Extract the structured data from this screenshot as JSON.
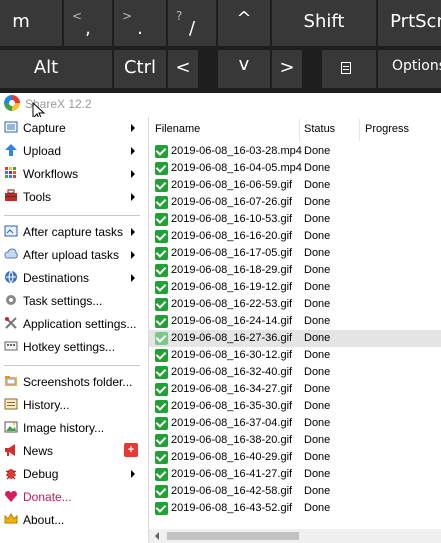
{
  "keyboard": {
    "keys_row1": [
      {
        "main": "m"
      },
      {
        "top": "<",
        "main": ","
      },
      {
        "top": ">",
        "main": "."
      },
      {
        "top": "?",
        "main": "/"
      },
      {
        "main": "^"
      },
      {
        "main": "Shift"
      },
      {
        "main": "PrtScn"
      }
    ],
    "keys_row2": [
      {
        "main": "Alt"
      },
      {
        "main": "Ctrl"
      },
      {
        "main": "<"
      },
      {
        "main": "v"
      },
      {
        "main": ">"
      },
      {
        "icon": "menu-key-icon"
      },
      {
        "main": "Options"
      }
    ]
  },
  "app": {
    "title": "ShareX 12.2",
    "menu": [
      {
        "label": "Capture",
        "icon": "capture-icon",
        "submenu": true
      },
      {
        "label": "Upload",
        "icon": "upload-arrow-icon",
        "submenu": true
      },
      {
        "label": "Workflows",
        "icon": "workflows-grid-icon",
        "submenu": true
      },
      {
        "label": "Tools",
        "icon": "toolbox-icon",
        "submenu": true
      },
      {
        "label": "After capture tasks",
        "icon": "after-capture-icon",
        "submenu": true
      },
      {
        "label": "After upload tasks",
        "icon": "after-upload-icon",
        "submenu": true
      },
      {
        "label": "Destinations",
        "icon": "destinations-icon",
        "submenu": true
      },
      {
        "label": "Task settings...",
        "icon": "task-settings-icon",
        "submenu": false
      },
      {
        "label": "Application settings...",
        "icon": "application-settings-icon",
        "submenu": false
      },
      {
        "label": "Hotkey settings...",
        "icon": "hotkey-settings-icon",
        "submenu": false
      },
      {
        "label": "Screenshots folder...",
        "icon": "screenshots-folder-icon",
        "submenu": false
      },
      {
        "label": "History...",
        "icon": "history-icon",
        "submenu": false
      },
      {
        "label": "Image history...",
        "icon": "image-history-icon",
        "submenu": false
      },
      {
        "label": "News",
        "icon": "news-megaphone-icon",
        "submenu": false,
        "badge": "+"
      },
      {
        "label": "Debug",
        "icon": "debug-icon",
        "submenu": true
      },
      {
        "label": "Donate...",
        "icon": "donate-heart-icon",
        "submenu": false
      },
      {
        "label": "About...",
        "icon": "about-crown-icon",
        "submenu": false
      }
    ],
    "columns": {
      "filename": "Filename",
      "status": "Status",
      "progress": "Progress"
    },
    "files": [
      {
        "name": "2019-06-08_16-03-28.mp4",
        "status": "Done"
      },
      {
        "name": "2019-06-08_16-04-05.mp4",
        "status": "Done"
      },
      {
        "name": "2019-06-08_16-06-59.gif",
        "status": "Done"
      },
      {
        "name": "2019-06-08_16-07-26.gif",
        "status": "Done"
      },
      {
        "name": "2019-06-08_16-10-53.gif",
        "status": "Done"
      },
      {
        "name": "2019-06-08_16-16-20.gif",
        "status": "Done"
      },
      {
        "name": "2019-06-08_16-17-05.gif",
        "status": "Done"
      },
      {
        "name": "2019-06-08_16-18-29.gif",
        "status": "Done"
      },
      {
        "name": "2019-06-08_16-19-12.gif",
        "status": "Done"
      },
      {
        "name": "2019-06-08_16-22-53.gif",
        "status": "Done"
      },
      {
        "name": "2019-06-08_16-24-14.gif",
        "status": "Done"
      },
      {
        "name": "2019-06-08_16-27-36.gif",
        "status": "Done",
        "selected": true
      },
      {
        "name": "2019-06-08_16-30-12.gif",
        "status": "Done"
      },
      {
        "name": "2019-06-08_16-32-40.gif",
        "status": "Done"
      },
      {
        "name": "2019-06-08_16-34-27.gif",
        "status": "Done"
      },
      {
        "name": "2019-06-08_16-35-30.gif",
        "status": "Done"
      },
      {
        "name": "2019-06-08_16-37-04.gif",
        "status": "Done"
      },
      {
        "name": "2019-06-08_16-38-20.gif",
        "status": "Done"
      },
      {
        "name": "2019-06-08_16-40-29.gif",
        "status": "Done"
      },
      {
        "name": "2019-06-08_16-41-27.gif",
        "status": "Done"
      },
      {
        "name": "2019-06-08_16-42-58.gif",
        "status": "Done"
      },
      {
        "name": "2019-06-08_16-43-52.gif",
        "status": "Done"
      }
    ],
    "colors": {
      "done_check": "#21a035",
      "selection": "#e5e5e5",
      "keyboard_key": "#383838"
    }
  }
}
